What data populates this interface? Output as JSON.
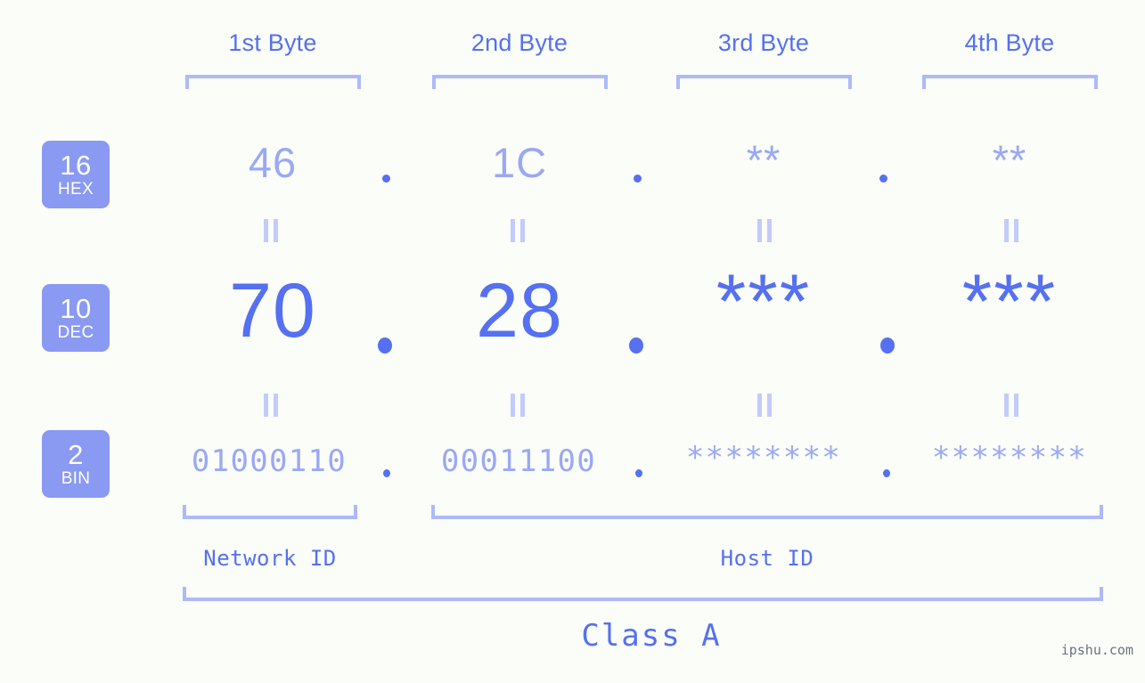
{
  "background_color": "#fbfdf8",
  "accent_color": "#5570f1",
  "muted_color": "#9aa8f6",
  "bracket_color": "#aeb9fb",
  "badge_color": "#8a99f2",
  "byte_headers": [
    {
      "label": "1st Byte"
    },
    {
      "label": "2nd Byte"
    },
    {
      "label": "3rd Byte"
    },
    {
      "label": "4th Byte"
    }
  ],
  "radix_badges": [
    {
      "num": "16",
      "sub": "HEX"
    },
    {
      "num": "10",
      "sub": "DEC"
    },
    {
      "num": "2",
      "sub": "BIN"
    }
  ],
  "rows": {
    "hex": {
      "values": [
        "46",
        "1C",
        "**",
        "**"
      ]
    },
    "dec": {
      "values": [
        "70",
        "28",
        "***",
        "***"
      ]
    },
    "bin": {
      "values": [
        "01000110",
        "00011100",
        "********",
        "********"
      ]
    }
  },
  "separators": {
    "dot": "."
  },
  "segments": {
    "network_id": "Network ID",
    "host_id": "Host ID",
    "class": "Class A"
  },
  "watermark": "ipshu.com"
}
